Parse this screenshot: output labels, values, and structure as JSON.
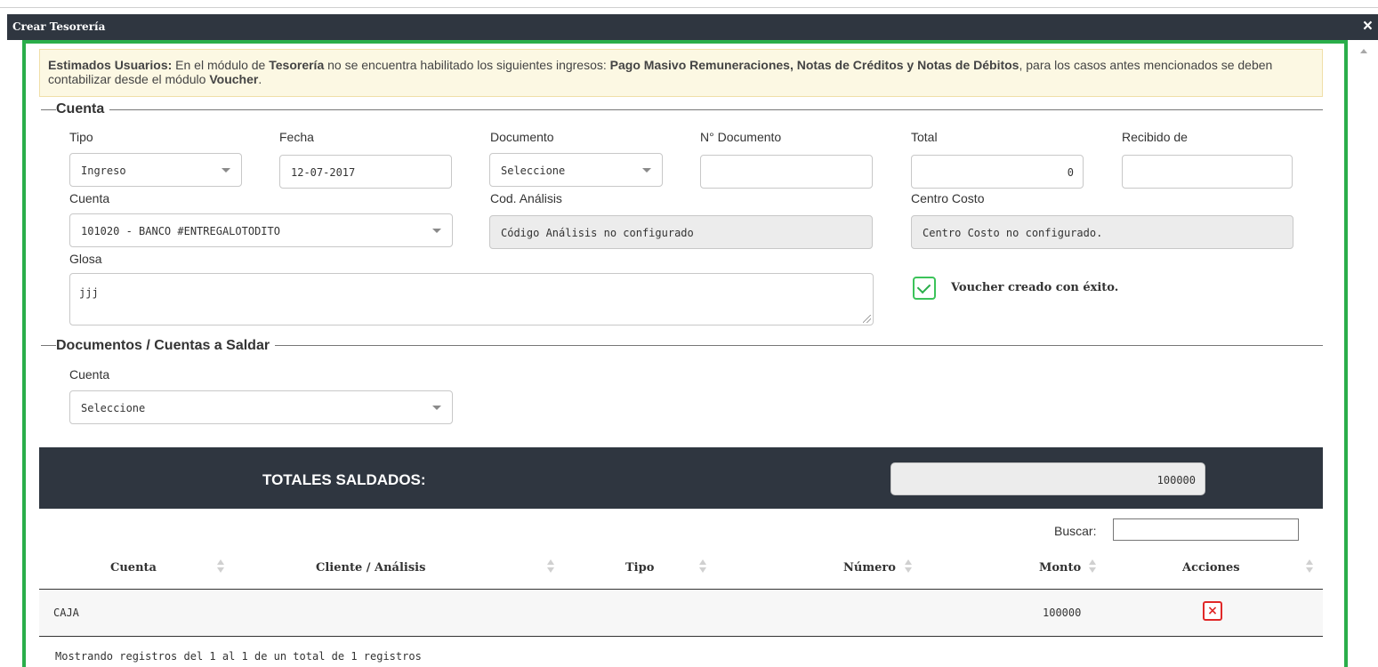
{
  "window": {
    "title": "Crear Tesorería",
    "close_icon": "×"
  },
  "notice": {
    "p1": "Estimados Usuarios:",
    "p2": " En el módulo de ",
    "p3": "Tesorería",
    "p4": " no se encuentra habilitado los siguientes ingresos: ",
    "p5": "Pago Masivo Remuneraciones, Notas de Créditos y Notas de Débitos",
    "p6": ", para los casos antes mencionados se deben contabilizar desde el módulo ",
    "p7": "Voucher",
    "p8": "."
  },
  "cuenta_section": {
    "legend": "Cuenta",
    "tipo": {
      "label": "Tipo",
      "value": "Ingreso"
    },
    "fecha": {
      "label": "Fecha",
      "value": "12-07-2017"
    },
    "documento": {
      "label": "Documento",
      "value": "Seleccione"
    },
    "n_documento": {
      "label": "N° Documento",
      "value": ""
    },
    "total": {
      "label": "Total",
      "value": "0"
    },
    "recibido_de": {
      "label": "Recibido de",
      "value": ""
    },
    "cuenta": {
      "label": "Cuenta",
      "value": "101020 - BANCO #ENTREGALOTODITO"
    },
    "cod_analisis": {
      "label": "Cod. Análisis",
      "value": "Código Análisis no configurado"
    },
    "centro_costo": {
      "label": "Centro Costo",
      "value": "Centro Costo no configurado."
    },
    "glosa": {
      "label": "Glosa",
      "value": "jjj"
    },
    "voucher_msg": "Voucher creado con éxito."
  },
  "docs_section": {
    "legend": "Documentos / Cuentas a Saldar",
    "cuenta": {
      "label": "Cuenta",
      "value": "Seleccione"
    }
  },
  "totals": {
    "label": "TOTALES SALDADOS:",
    "value": "100000"
  },
  "table": {
    "search_label": "Buscar:",
    "headers": [
      "Cuenta",
      "Cliente / Análisis",
      "Tipo",
      "Número",
      "Monto",
      "Acciones"
    ],
    "rows": [
      {
        "cuenta": "CAJA",
        "cliente": "",
        "tipo": "",
        "numero": "",
        "monto": "100000"
      }
    ],
    "info": "Mostrando registros del 1 al 1 de un total de 1 registros"
  },
  "colors": {
    "header_bg": "#2f3640",
    "frame_green": "#2aae4a",
    "notice_bg": "#fcf8e3",
    "danger": "#e02828"
  },
  "icons": {
    "close": "close-icon",
    "check": "check-icon",
    "delete": "delete-icon"
  }
}
